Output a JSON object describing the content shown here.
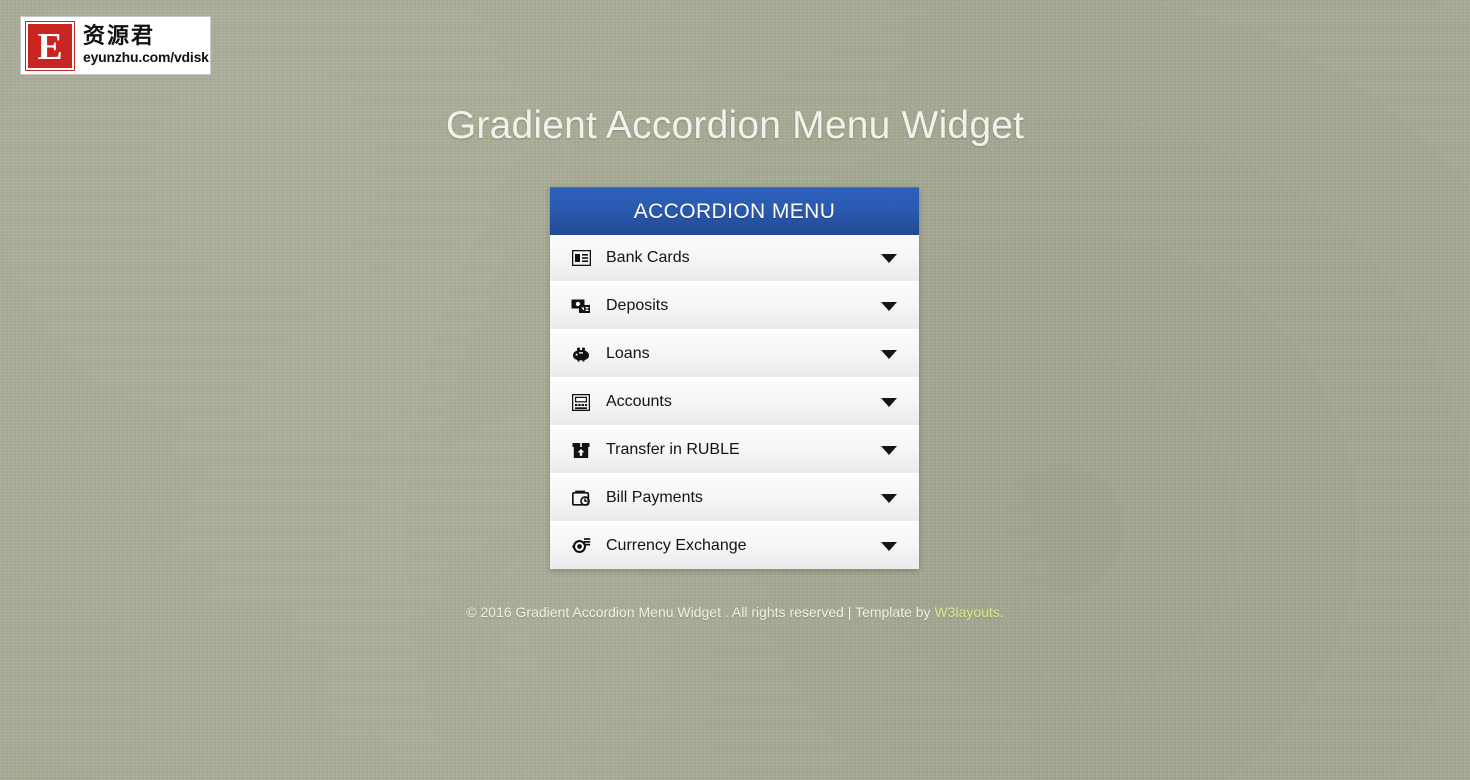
{
  "logo": {
    "mark_letter": "E",
    "cn_text": "资源君",
    "url_text": "eyunzhu.com/vdisk",
    "mark_color": "#c9241f"
  },
  "page": {
    "title": "Gradient Accordion Menu Widget",
    "background_color": "#a9ac96",
    "title_color": "#f2f2ec"
  },
  "accordion": {
    "header_label": "ACCORDION MENU",
    "header_gradient_top": "#2d61bd",
    "header_gradient_bottom": "#224a93",
    "items": [
      {
        "label": "Bank Cards",
        "icon": "id-card-icon",
        "arrow": "chevron-down-icon"
      },
      {
        "label": "Deposits",
        "icon": "money-cards-icon",
        "arrow": "chevron-down-icon"
      },
      {
        "label": "Loans",
        "icon": "piggy-bank-icon",
        "arrow": "chevron-down-icon"
      },
      {
        "label": "Accounts",
        "icon": "atm-machine-icon",
        "arrow": "chevron-down-icon"
      },
      {
        "label": "Transfer in RUBLE",
        "icon": "box-upload-icon",
        "arrow": "chevron-down-icon"
      },
      {
        "label": "Bill Payments",
        "icon": "wallet-icon",
        "arrow": "chevron-down-icon"
      },
      {
        "label": "Currency Exchange",
        "icon": "coin-exchange-icon",
        "arrow": "chevron-down-icon"
      }
    ]
  },
  "footer": {
    "text_before": "© 2016 Gradient Accordion Menu Widget . All rights reserved | Template by ",
    "link_label": "W3layouts",
    "text_after": ".",
    "link_color": "#dbe88e"
  }
}
